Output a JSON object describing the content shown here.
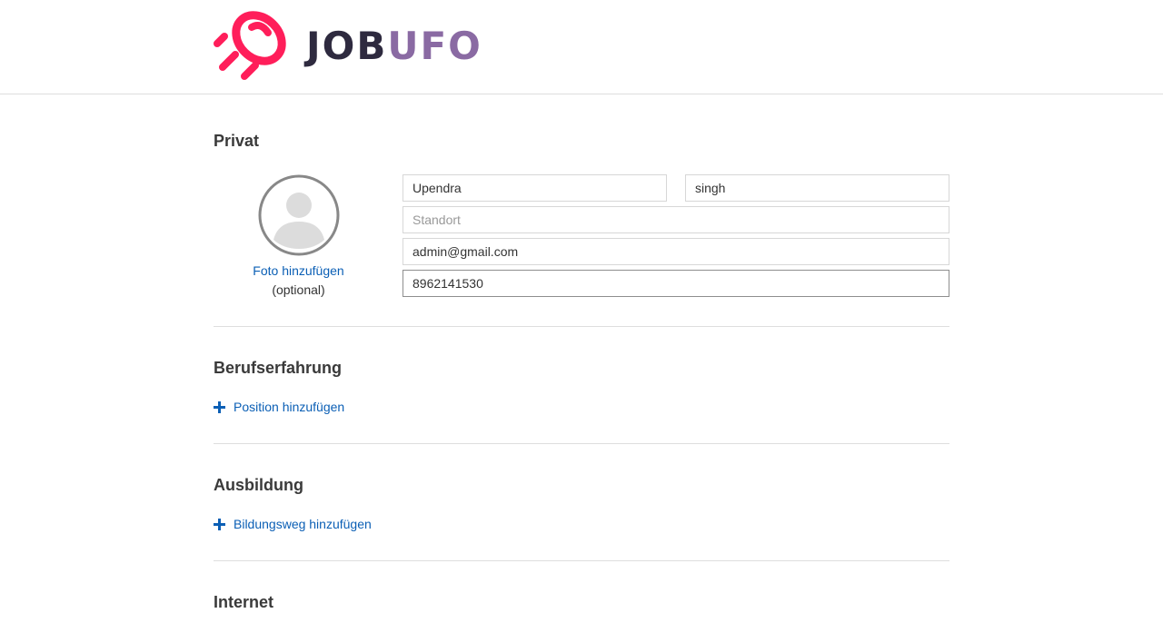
{
  "brand": {
    "logo_part_a": "JOB",
    "logo_part_b": "UFO",
    "colors": {
      "rocket": "#ff1e5a",
      "text_dark": "#2e2a3f",
      "text_purple": "#8a6aa3"
    }
  },
  "sections": {
    "private": {
      "title": "Privat",
      "photo": {
        "link_label": "Foto hinzufügen",
        "optional_label": "(optional)"
      },
      "fields": {
        "first_name": {
          "value": "Upendra",
          "placeholder": ""
        },
        "last_name": {
          "value": "singh",
          "placeholder": ""
        },
        "location": {
          "value": "",
          "placeholder": "Standort"
        },
        "email": {
          "value": "admin@gmail.com",
          "placeholder": ""
        },
        "phone": {
          "value": "8962141530",
          "placeholder": ""
        }
      }
    },
    "experience": {
      "title": "Berufserfahrung",
      "add_label": "Position hinzufügen"
    },
    "education": {
      "title": "Ausbildung",
      "add_label": "Bildungsweg hinzufügen"
    },
    "internet": {
      "title": "Internet"
    }
  },
  "theme": {
    "link_color": "#0b5fb5",
    "divider_color": "#dedede"
  }
}
